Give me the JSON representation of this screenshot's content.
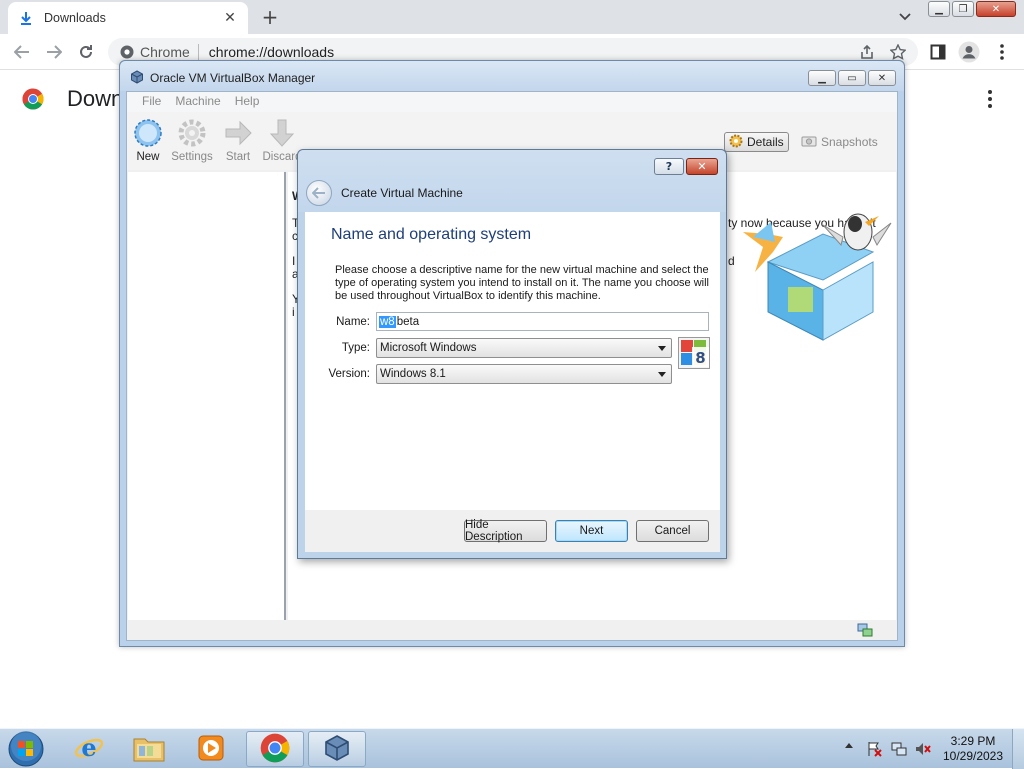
{
  "browser": {
    "tab": {
      "title": "Downloads"
    },
    "omnibox": {
      "chip": "Chrome",
      "url": "chrome://downloads"
    },
    "page_title": "Down"
  },
  "vbox": {
    "title": "Oracle VM VirtualBox Manager",
    "menu": [
      "File",
      "Machine",
      "Help"
    ],
    "tools": [
      "New",
      "Settings",
      "Start",
      "Discard"
    ],
    "details_label": "Details",
    "snapshots_label": "Snapshots",
    "peek": {
      "heading": "W",
      "line1": "T",
      "line1b": "c",
      "line2": "I",
      "line2b": "a",
      "line3": "Y",
      "line3b": "i",
      "right_text": "ty now because you haven't",
      "right_d": "d"
    }
  },
  "dialog": {
    "title": "Create Virtual Machine",
    "help_label": "?",
    "close_label": "✕",
    "section_title": "Name and operating system",
    "description": "Please choose a descriptive name for the new virtual machine and select the type of operating system you intend to install on it. The name you choose will be used throughout VirtualBox to identify this machine.",
    "name_label": "Name:",
    "name_selected": "w8",
    "name_rest": "beta",
    "type_label": "Type:",
    "type_value": "Microsoft Windows",
    "version_label": "Version:",
    "version_value": "Windows 8.1",
    "os_badge": "8",
    "buttons": {
      "hide_description": "Hide Description",
      "next": "Next",
      "cancel": "Cancel"
    }
  },
  "taskbar": {
    "clock_time": "3:29 PM",
    "clock_date": "10/29/2023"
  },
  "colors": {
    "accent_blue": "#1e3f78",
    "selection": "#3399ff",
    "taskbar": "#b4cbe2"
  }
}
